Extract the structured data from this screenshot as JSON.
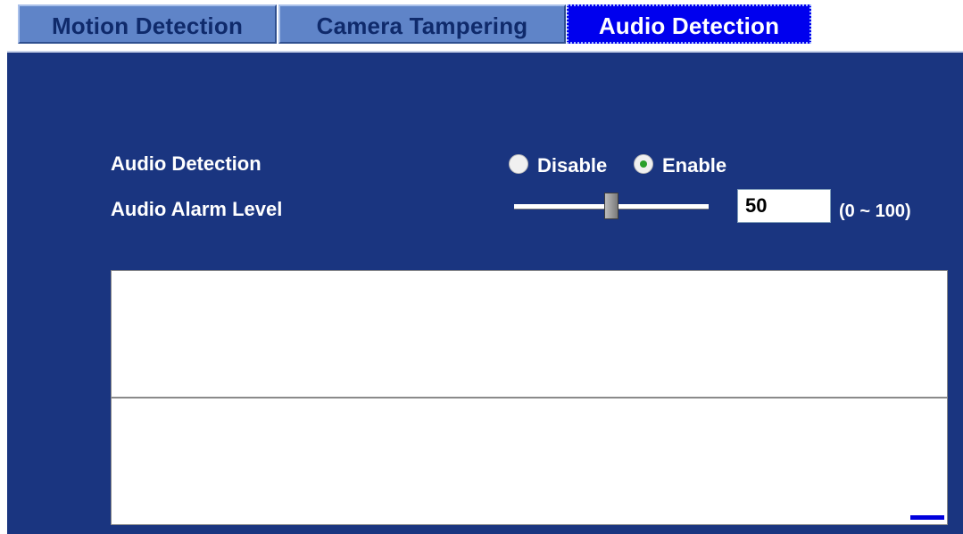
{
  "tabs": [
    {
      "label": "Motion Detection",
      "active": false
    },
    {
      "label": "Camera Tampering",
      "active": false
    },
    {
      "label": "Audio Detection",
      "active": true
    }
  ],
  "form": {
    "detection_label": "Audio Detection",
    "disable_label": "Disable",
    "enable_label": "Enable",
    "selected": "Enable",
    "level_label": "Audio Alarm Level",
    "level_value": "50",
    "level_fraction": 0.5,
    "range_note": "(0 ~ 100)"
  },
  "graph": {
    "level_indicator_color": "#0000dd"
  },
  "colors": {
    "panel_bg": "#1a3580",
    "active_tab": "#0000ee",
    "inactive_tab": "#5f84c8"
  }
}
